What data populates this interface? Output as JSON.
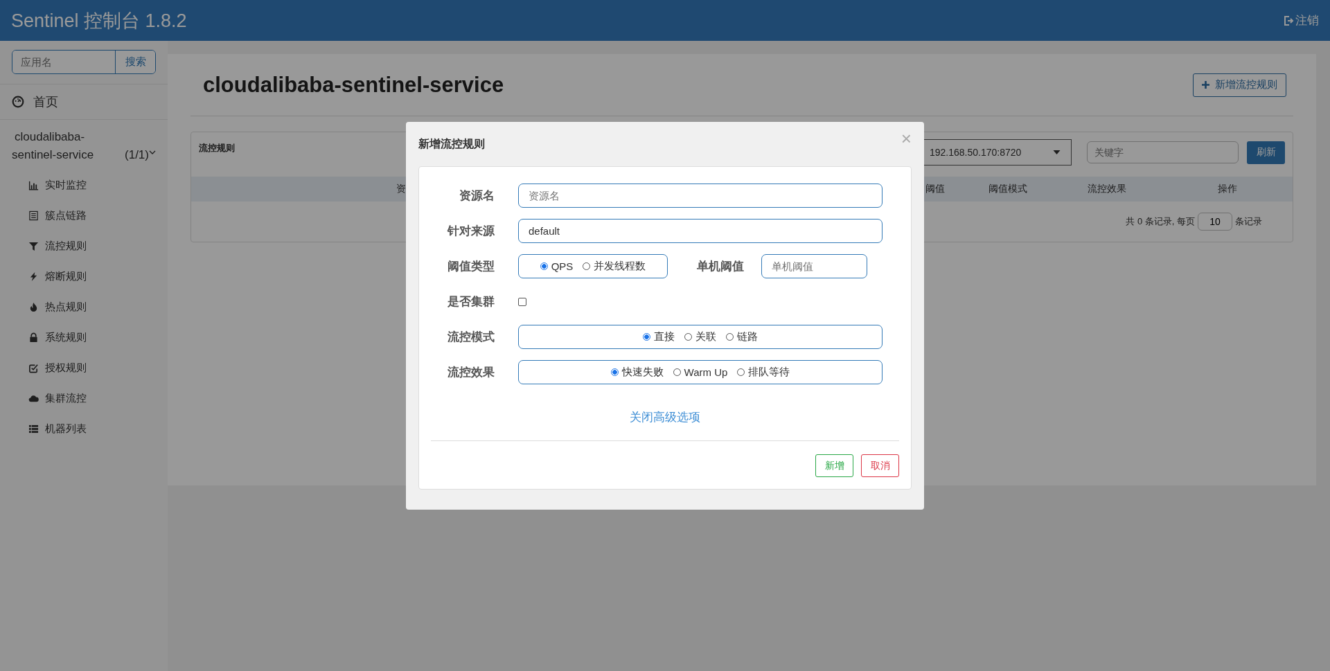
{
  "header": {
    "title": "Sentinel 控制台 1.8.2",
    "logout": "注销"
  },
  "sidebar": {
    "search": {
      "placeholder": "应用名",
      "button": "搜索"
    },
    "home": "首页",
    "app": {
      "name": "cloudalibaba-sentinel-service",
      "count": "(1/1)",
      "expanded": true
    },
    "items": [
      {
        "label": "实时监控",
        "kind": "chart"
      },
      {
        "label": "簇点链路",
        "kind": "list"
      },
      {
        "label": "流控规则",
        "kind": "filter"
      },
      {
        "label": "熔断规则",
        "kind": "bolt"
      },
      {
        "label": "热点规则",
        "kind": "fire"
      },
      {
        "label": "系统规则",
        "kind": "lock"
      },
      {
        "label": "授权规则",
        "kind": "check"
      },
      {
        "label": "集群流控",
        "kind": "cloud"
      },
      {
        "label": "机器列表",
        "kind": "table"
      }
    ]
  },
  "main": {
    "title": "cloudalibaba-sentinel-service",
    "add_button": "新增流控规则",
    "panel": {
      "title": "流控规则",
      "machine": "192.168.50.170:8720",
      "keyword_placeholder": "关键字",
      "refresh": "刷新",
      "columns": [
        "资",
        "阈值",
        "阈值模式",
        "流控效果",
        "操作"
      ],
      "footer": {
        "total": "共 0 条记录, 每页",
        "page_size": "10",
        "suffix": "条记录"
      }
    }
  },
  "modal": {
    "title": "新增流控规则",
    "close": "×",
    "rows": [
      {
        "kind": "input",
        "label": "资源名",
        "placeholder": "资源名"
      },
      {
        "kind": "input",
        "label": "针对来源",
        "value": "default"
      },
      {
        "kind": "radio_pair",
        "label": "阈值类型",
        "options": [
          {
            "label": "QPS",
            "selected": true
          },
          {
            "label": "并发线程数",
            "selected": false
          }
        ],
        "side_label": "单机阈值",
        "side_placeholder": "单机阈值"
      },
      {
        "kind": "checkbox",
        "label": "是否集群",
        "checked": false
      },
      {
        "kind": "radio",
        "label": "流控模式",
        "options": [
          {
            "label": "直接",
            "selected": true
          },
          {
            "label": "关联",
            "selected": false
          },
          {
            "label": "链路",
            "selected": false
          }
        ]
      },
      {
        "kind": "radio",
        "label": "流控效果",
        "options": [
          {
            "label": "快速失败",
            "selected": true
          },
          {
            "label": "Warm Up",
            "selected": false
          },
          {
            "label": "排队等待",
            "selected": false
          }
        ]
      }
    ],
    "advanced_link": "关闭高级选项",
    "buttons": [
      {
        "label": "新增",
        "kind": "confirm"
      },
      {
        "label": "取消",
        "kind": "cancel"
      }
    ]
  }
}
